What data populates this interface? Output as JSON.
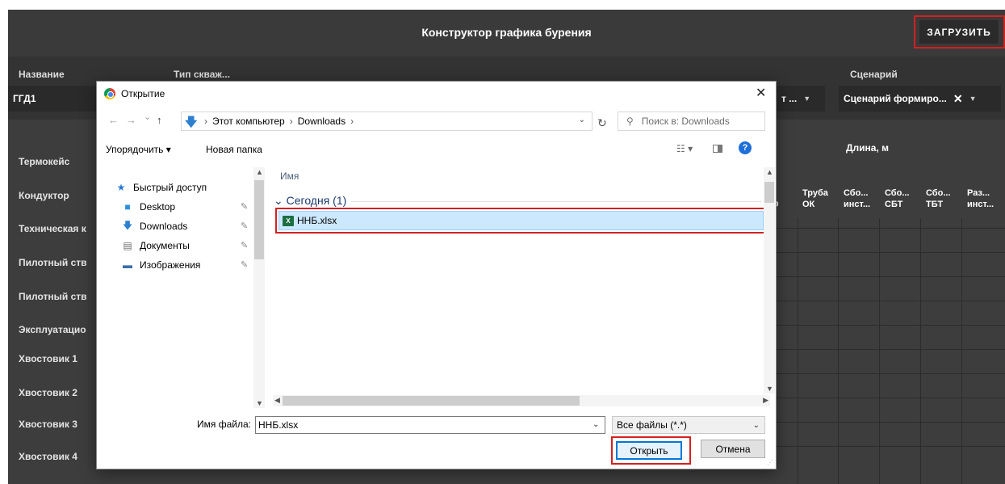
{
  "app": {
    "title": "Конструктор графика бурения",
    "load_button": "ЗАГРУЗИТЬ",
    "form": {
      "name_label": "Название",
      "name_value": "ГГД1",
      "well_type_label": "Тип скваж...",
      "partial_field": "т ...",
      "scenario_label": "Сценарий",
      "scenario_value": "Сценарий формиро...",
      "scenario_clear": "✕"
    },
    "length_header": "Длина, м",
    "rows": [
      "Термокейс",
      "Кондуктор",
      "Техническая к",
      "Пилотный ств",
      "Пилотный ств",
      "Эксплуатацио",
      "Хвостовик 1",
      "Хвостовик 2",
      "Хвостовик 3",
      "Хвостовик 4"
    ],
    "columns": [
      {
        "l1": "г.",
        "l2": "О"
      },
      {
        "l1": "Труба",
        "l2": "ОК"
      },
      {
        "l1": "Сбо...",
        "l2": "инст..."
      },
      {
        "l1": "Сбо...",
        "l2": "СБТ"
      },
      {
        "l1": "Сбо...",
        "l2": "ТБТ"
      },
      {
        "l1": "Раз...",
        "l2": "инст..."
      }
    ]
  },
  "dialog": {
    "title": "Открытие",
    "close": "✕",
    "nav": {
      "back": "←",
      "forward": "→",
      "recent": "⌄",
      "up": "↑"
    },
    "breadcrumb": [
      "Этот компьютер",
      "Downloads"
    ],
    "refresh": "↻",
    "search_placeholder": "Поиск в: Downloads",
    "toolbar": {
      "organize": "Упорядочить ▾",
      "new_folder": "Новая папка",
      "view": "☷ ▾",
      "help": "?"
    },
    "sidebar": [
      {
        "icon": "star-icon",
        "label": "Быстрый доступ",
        "glyph": "★",
        "color": "#2a7ad5"
      },
      {
        "icon": "desktop-folder-icon",
        "label": "Desktop",
        "glyph": "■",
        "color": "#2d8fd8"
      },
      {
        "icon": "downloads-icon",
        "label": "Downloads",
        "glyph": "🡇",
        "color": "#2d7fd0"
      },
      {
        "icon": "documents-icon",
        "label": "Документы",
        "glyph": "▤",
        "color": "#6b6b6b"
      },
      {
        "icon": "pictures-icon",
        "label": "Изображения",
        "glyph": "▬",
        "color": "#3b6ea8"
      }
    ],
    "column_name": "Имя",
    "group_header": "Сегодня (1)",
    "file_name": "ННБ.xlsx",
    "filename_label": "Имя файла:",
    "filename_value": "ННБ.xlsx",
    "filetype_value": "Все файлы (*.*)",
    "open_button": "Открыть",
    "cancel_button": "Отмена"
  }
}
